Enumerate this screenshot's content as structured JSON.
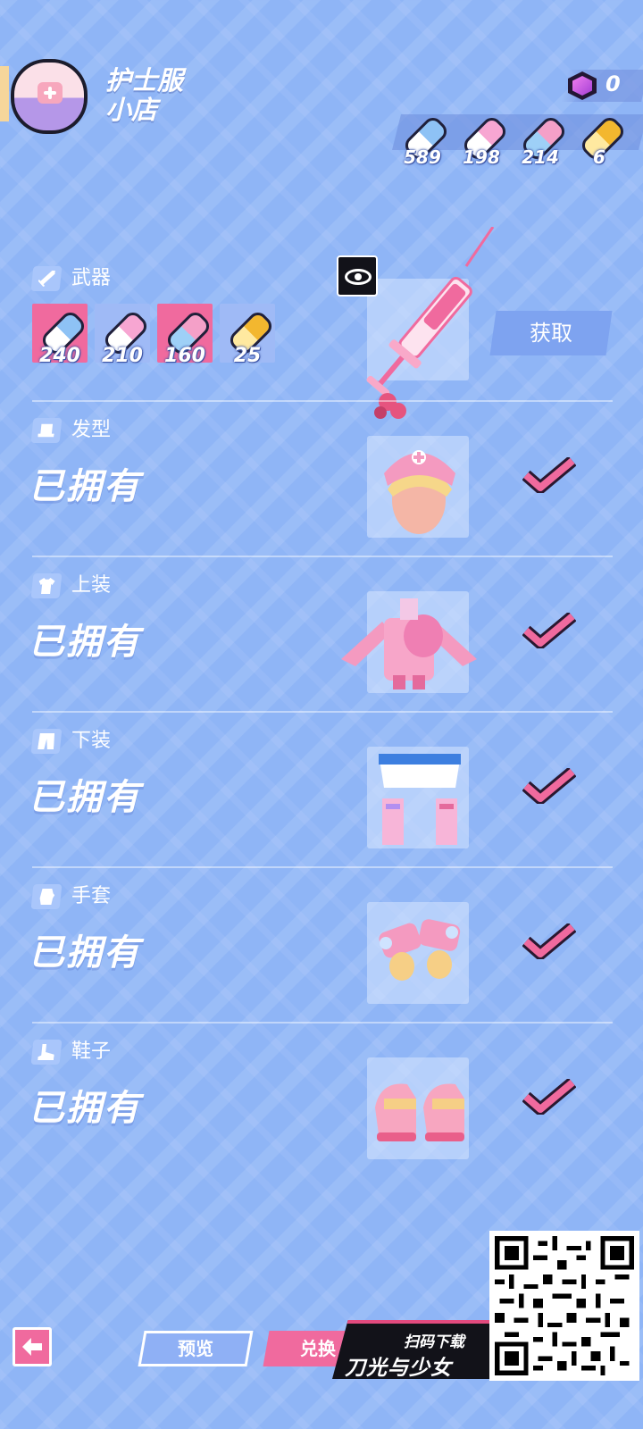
{
  "shop": {
    "title": "护士服\n小店"
  },
  "currency": {
    "gem_count": "0",
    "pills": [
      {
        "color": "blue",
        "amount": "589"
      },
      {
        "color": "pink",
        "amount": "198"
      },
      {
        "color": "pinkblue",
        "amount": "214"
      },
      {
        "color": "gold",
        "amount": "6"
      }
    ]
  },
  "weapon": {
    "category": "武器",
    "costs": [
      "240",
      "210",
      "160",
      "25"
    ],
    "acquire_label": "获取"
  },
  "items": [
    {
      "category": "发型",
      "status": "已拥有"
    },
    {
      "category": "上装",
      "status": "已拥有"
    },
    {
      "category": "下装",
      "status": "已拥有"
    },
    {
      "category": "手套",
      "status": "已拥有"
    },
    {
      "category": "鞋子",
      "status": "已拥有"
    }
  ],
  "bottom_bar": {
    "preview_label": "预览",
    "exchange_label": "兑换",
    "promo_scan": "扫码下载",
    "promo_name": "刀光与少女"
  },
  "colors": {
    "accent_pink": "#f06a9e",
    "background": "#8fb5f6"
  }
}
